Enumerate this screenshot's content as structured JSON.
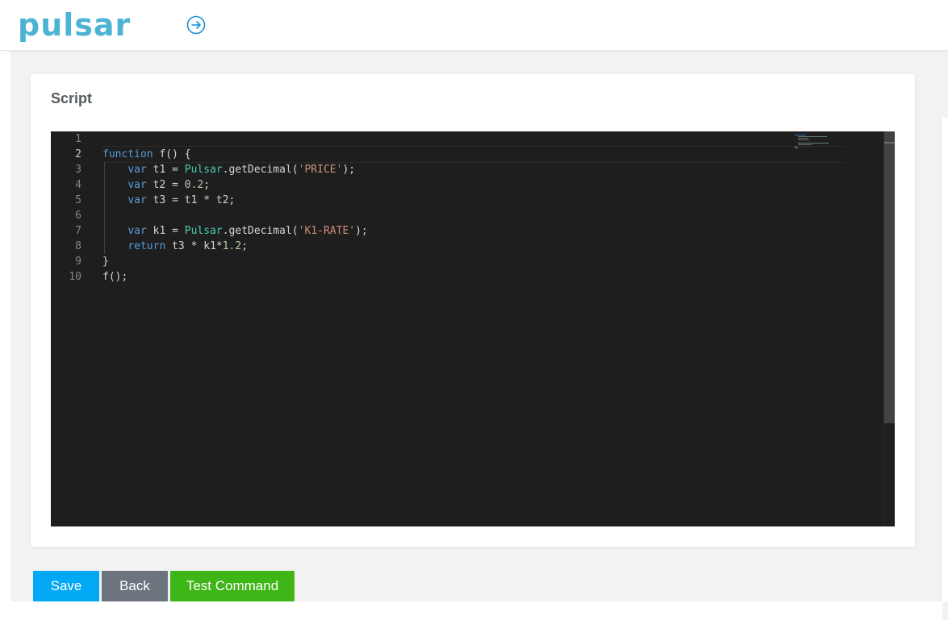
{
  "header": {
    "logo_text": "pulsar",
    "logo_color": "#4cb3d3",
    "nav_icon": "arrow-right-circle-icon"
  },
  "card": {
    "title": "Script"
  },
  "editor": {
    "theme_background": "#1e1e1e",
    "active_line": 2,
    "line_numbers": [
      "1",
      "2",
      "3",
      "4",
      "5",
      "6",
      "7",
      "8",
      "9",
      "10"
    ],
    "code_lines": [
      "",
      "function f() {",
      "    var t1 = Pulsar.getDecimal('PRICE');",
      "    var t2 = 0.2;",
      "    var t3 = t1 * t2;",
      "",
      "    var k1 = Pulsar.getDecimal('K1-RATE');",
      "    return t3 * k1*1.2;",
      "}",
      "f();"
    ]
  },
  "actions": {
    "save_label": "Save",
    "back_label": "Back",
    "test_label": "Test Command",
    "colors": {
      "save": "#03a9f4",
      "back": "#6c757d",
      "test": "#3fb618"
    }
  }
}
